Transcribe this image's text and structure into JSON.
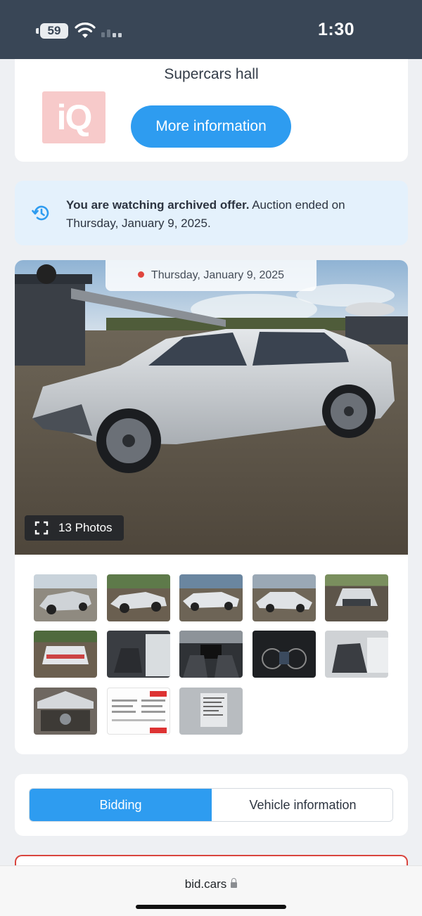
{
  "status_bar": {
    "battery": "59",
    "time": "1:30"
  },
  "info_card": {
    "hall_text": "Supercars hall",
    "logo_text": "iQ",
    "more_button": "More information"
  },
  "notice": {
    "bold": "You are watching archived offer.",
    "rest": " Auction ended on Thursday, January 9, 2025."
  },
  "gallery": {
    "date": "Thursday, January 9, 2025",
    "photos_label": "13 Photos",
    "thumbnails": [
      {
        "name": "thumb-front-left"
      },
      {
        "name": "thumb-side-left"
      },
      {
        "name": "thumb-rear-left"
      },
      {
        "name": "thumb-front-left-damage"
      },
      {
        "name": "thumb-front"
      },
      {
        "name": "thumb-rear"
      },
      {
        "name": "thumb-interior-front"
      },
      {
        "name": "thumb-dashboard"
      },
      {
        "name": "thumb-instrument-cluster"
      },
      {
        "name": "thumb-interior-rear"
      },
      {
        "name": "thumb-engine"
      },
      {
        "name": "thumb-window-sticker"
      },
      {
        "name": "thumb-label"
      }
    ]
  },
  "tabs": {
    "bidding": "Bidding",
    "vehicle_information": "Vehicle information"
  },
  "url_bar": {
    "url": "bid.cars"
  },
  "colors": {
    "accent": "#2e9cf0",
    "status_bar": "#394656",
    "notice_bg": "#e4f1fc",
    "alert": "#d9453e"
  }
}
